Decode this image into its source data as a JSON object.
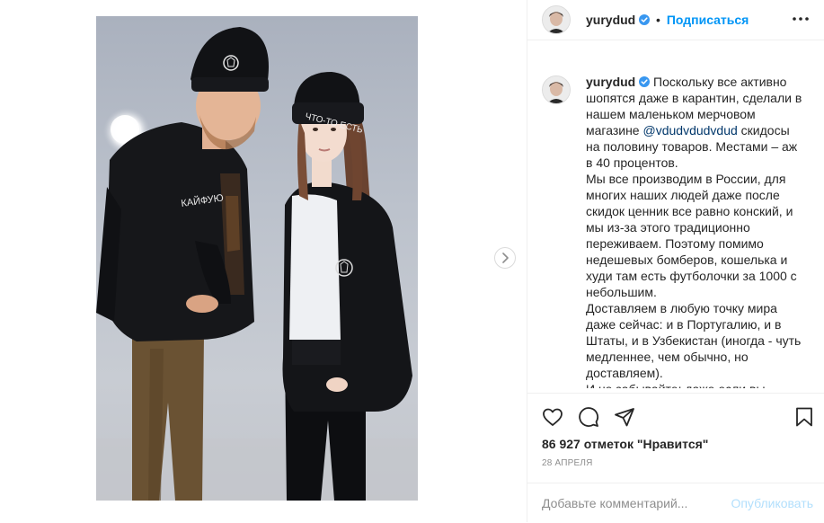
{
  "post": {
    "username": "yurydud",
    "dot": "•",
    "follow_label": "Подписаться",
    "caption_username": "yurydud",
    "caption_lines": [
      "Поскольку все активно",
      "шопятся даже в карантин, сделали в",
      "нашем маленьком мерчовом",
      "магазине",
      "на половину товаров. Местами – аж",
      "в 40 процентов.",
      "Мы все производим в России, для",
      "многих наших людей даже после",
      "скидок ценник все равно конский, и",
      "мы из-за этого традиционно",
      "переживаем. Поэтому помимо",
      "недешевых бомберов, кошелька и",
      "худи там есть футболочки за 1000 с",
      "небольшим.",
      "Доставляем в любую точку мира",
      "даже сейчас: и в Португалию, и в",
      "Штаты, и в Узбекистан (иногда - чуть",
      "медленнее, чем обычно, но",
      "доставляем).",
      "И не забывайте: даже если вы"
    ],
    "mention": "@vdudvdudvdud",
    "mention_suffix": " скидосы",
    "likes": "86 927 отметок \"Нравится\"",
    "date": "28 апреля",
    "comment_placeholder": "Добавьте комментарий...",
    "publish_label": "Опубликовать"
  },
  "photo": {
    "beanie_text_right": "ЧТО-ТО ЕСТЬ",
    "jacket_text_left": "КАЙФУЮ"
  },
  "icons": {
    "verified": "verified-badge-icon",
    "more": "more-dots-icon",
    "next": "chevron-right-icon",
    "like": "heart-icon",
    "comment": "comment-bubble-icon",
    "share": "paper-plane-icon",
    "save": "bookmark-icon"
  },
  "colors": {
    "accent": "#0095f6",
    "verified": "#3897f0",
    "mention": "#00376b",
    "publish_disabled": "#b2dffc",
    "border": "#efefef"
  }
}
